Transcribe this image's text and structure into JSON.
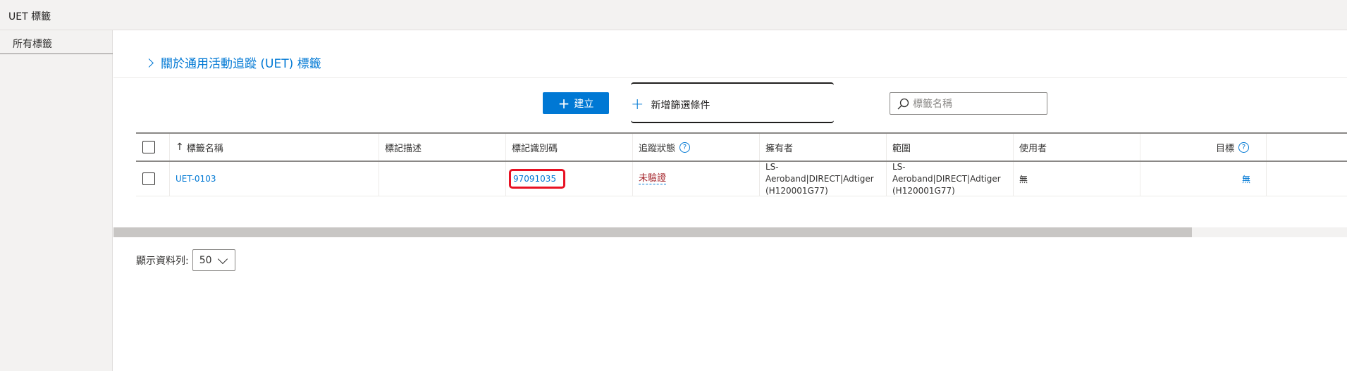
{
  "app": {
    "title": "UET 標籤"
  },
  "sidebar": {
    "items": [
      {
        "label": "所有標籤"
      }
    ]
  },
  "about_link": "關於通用活動追蹤 (UET) 標籤",
  "toolbar": {
    "create_label": "建立",
    "add_filter_label": "新增篩選條件",
    "search_placeholder": "標籤名稱"
  },
  "table": {
    "columns": {
      "name": "標籤名稱",
      "description": "標記描述",
      "tag_id": "標記識別碼",
      "status": "追蹤狀態",
      "owner": "擁有者",
      "scope": "範圍",
      "users": "使用者",
      "goals": "目標"
    },
    "rows": [
      {
        "name": "UET-0103",
        "description": "",
        "tag_id": "97091035",
        "status": "未驗證",
        "owner": "LS-Aeroband|DIRECT|Adtiger (H120001G77)",
        "scope": "LS-Aeroband|DIRECT|Adtiger (H120001G77)",
        "users": "無",
        "goals": "無"
      }
    ]
  },
  "pager": {
    "label": "顯示資料列:",
    "value": "50"
  },
  "colors": {
    "accent": "#0078d4",
    "highlight_box": "#e81123",
    "status_warning": "#a4262c"
  },
  "icons": {
    "search": "search-icon",
    "sort": "sort-up-arrow-icon",
    "help": "help-circle-icon",
    "chevron": "chevron-right-icon"
  }
}
